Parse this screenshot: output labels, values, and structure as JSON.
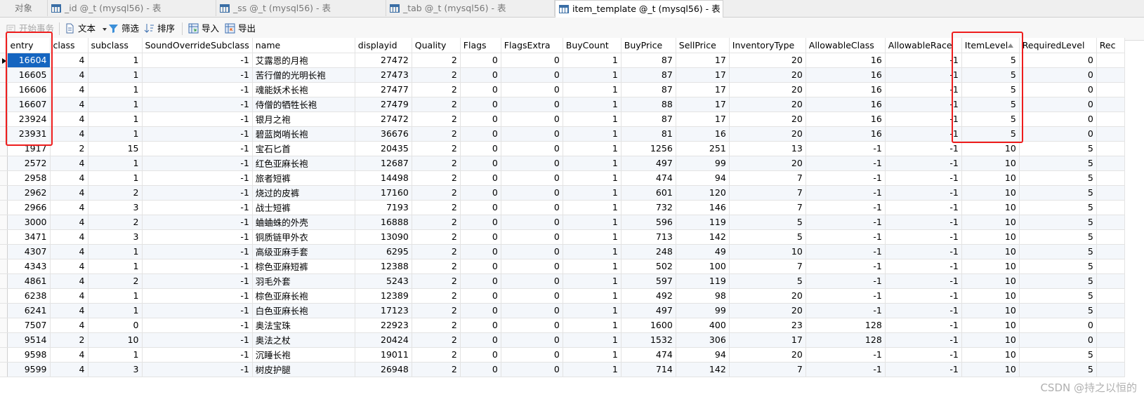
{
  "tabs": [
    {
      "label": "对象",
      "active": false
    },
    {
      "label": "_id @_t (mysql56) - 表",
      "active": false
    },
    {
      "label": "_ss @_t (mysql56) - 表",
      "active": false
    },
    {
      "label": "_tab @_t (mysql56) - 表",
      "active": false
    },
    {
      "label": "item_template @_t (mysql56) - 表",
      "active": true
    }
  ],
  "toolbar": {
    "begin_transaction": "开始事务",
    "text": "文本",
    "filter": "筛选",
    "sort": "排序",
    "import": "导入",
    "export": "导出"
  },
  "columns": [
    "entry",
    "class",
    "subclass",
    "SoundOverrideSubclass",
    "name",
    "displayid",
    "Quality",
    "Flags",
    "FlagsExtra",
    "BuyCount",
    "BuyPrice",
    "SellPrice",
    "InventoryType",
    "AllowableClass",
    "AllowableRace",
    "ItemLevel",
    "RequiredLevel",
    "Rec"
  ],
  "rows": [
    [
      "16604",
      "4",
      "1",
      "-1",
      "艾露恩的月袍",
      "27472",
      "2",
      "0",
      "0",
      "1",
      "87",
      "17",
      "20",
      "16",
      "-1",
      "5",
      "0"
    ],
    [
      "16605",
      "4",
      "1",
      "-1",
      "苦行僧的光明长袍",
      "27473",
      "2",
      "0",
      "0",
      "1",
      "87",
      "17",
      "20",
      "16",
      "-1",
      "5",
      "0"
    ],
    [
      "16606",
      "4",
      "1",
      "-1",
      "魂能妖术长袍",
      "27477",
      "2",
      "0",
      "0",
      "1",
      "87",
      "17",
      "20",
      "16",
      "-1",
      "5",
      "0"
    ],
    [
      "16607",
      "4",
      "1",
      "-1",
      "侍僧的牺牲长袍",
      "27479",
      "2",
      "0",
      "0",
      "1",
      "88",
      "17",
      "20",
      "16",
      "-1",
      "5",
      "0"
    ],
    [
      "23924",
      "4",
      "1",
      "-1",
      "银月之袍",
      "27472",
      "2",
      "0",
      "0",
      "1",
      "87",
      "17",
      "20",
      "16",
      "-1",
      "5",
      "0"
    ],
    [
      "23931",
      "4",
      "1",
      "-1",
      "碧蓝岗哨长袍",
      "36676",
      "2",
      "0",
      "0",
      "1",
      "81",
      "16",
      "20",
      "16",
      "-1",
      "5",
      "0"
    ],
    [
      "1917",
      "2",
      "15",
      "-1",
      "宝石匕首",
      "20435",
      "2",
      "0",
      "0",
      "1",
      "1256",
      "251",
      "13",
      "-1",
      "-1",
      "10",
      "5"
    ],
    [
      "2572",
      "4",
      "1",
      "-1",
      "红色亚麻长袍",
      "12687",
      "2",
      "0",
      "0",
      "1",
      "497",
      "99",
      "20",
      "-1",
      "-1",
      "10",
      "5"
    ],
    [
      "2958",
      "4",
      "1",
      "-1",
      "旅者短裤",
      "14498",
      "2",
      "0",
      "0",
      "1",
      "474",
      "94",
      "7",
      "-1",
      "-1",
      "10",
      "5"
    ],
    [
      "2962",
      "4",
      "2",
      "-1",
      "烧过的皮裤",
      "17160",
      "2",
      "0",
      "0",
      "1",
      "601",
      "120",
      "7",
      "-1",
      "-1",
      "10",
      "5"
    ],
    [
      "2966",
      "4",
      "3",
      "-1",
      "战士短裤",
      "7193",
      "2",
      "0",
      "0",
      "1",
      "732",
      "146",
      "7",
      "-1",
      "-1",
      "10",
      "5"
    ],
    [
      "3000",
      "4",
      "2",
      "-1",
      "蛐蛐蛛的外壳",
      "16888",
      "2",
      "0",
      "0",
      "1",
      "596",
      "119",
      "5",
      "-1",
      "-1",
      "10",
      "5"
    ],
    [
      "3471",
      "4",
      "3",
      "-1",
      "铜质链甲外衣",
      "13090",
      "2",
      "0",
      "0",
      "1",
      "713",
      "142",
      "5",
      "-1",
      "-1",
      "10",
      "5"
    ],
    [
      "4307",
      "4",
      "1",
      "-1",
      "高级亚麻手套",
      "6295",
      "2",
      "0",
      "0",
      "1",
      "248",
      "49",
      "10",
      "-1",
      "-1",
      "10",
      "5"
    ],
    [
      "4343",
      "4",
      "1",
      "-1",
      "棕色亚麻短裤",
      "12388",
      "2",
      "0",
      "0",
      "1",
      "502",
      "100",
      "7",
      "-1",
      "-1",
      "10",
      "5"
    ],
    [
      "4861",
      "4",
      "2",
      "-1",
      "羽毛外套",
      "5243",
      "2",
      "0",
      "0",
      "1",
      "597",
      "119",
      "5",
      "-1",
      "-1",
      "10",
      "5"
    ],
    [
      "6238",
      "4",
      "1",
      "-1",
      "棕色亚麻长袍",
      "12389",
      "2",
      "0",
      "0",
      "1",
      "492",
      "98",
      "20",
      "-1",
      "-1",
      "10",
      "5"
    ],
    [
      "6241",
      "4",
      "1",
      "-1",
      "白色亚麻长袍",
      "17123",
      "2",
      "0",
      "0",
      "1",
      "497",
      "99",
      "20",
      "-1",
      "-1",
      "10",
      "5"
    ],
    [
      "7507",
      "4",
      "0",
      "-1",
      "奥法宝珠",
      "22923",
      "2",
      "0",
      "0",
      "1",
      "1600",
      "400",
      "23",
      "128",
      "-1",
      "10",
      "0"
    ],
    [
      "9514",
      "2",
      "10",
      "-1",
      "奥法之杖",
      "20424",
      "2",
      "0",
      "0",
      "1",
      "1532",
      "306",
      "17",
      "128",
      "-1",
      "10",
      "0"
    ],
    [
      "9598",
      "4",
      "1",
      "-1",
      "沉睡长袍",
      "19011",
      "2",
      "0",
      "0",
      "1",
      "474",
      "94",
      "20",
      "-1",
      "-1",
      "10",
      "5"
    ],
    [
      "9599",
      "4",
      "3",
      "-1",
      "树皮护腿",
      "26948",
      "2",
      "0",
      "0",
      "1",
      "714",
      "142",
      "7",
      "-1",
      "-1",
      "10",
      "5"
    ]
  ],
  "watermark": "CSDN @持之以恒的",
  "colors": {
    "selected": "#1565c0",
    "highlight": "#ee1d1d"
  }
}
